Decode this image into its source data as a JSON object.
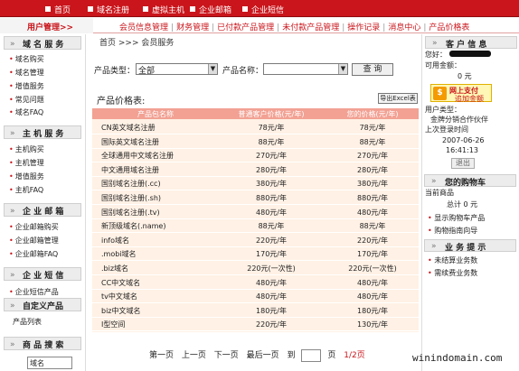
{
  "topnav": {
    "items": [
      "首页",
      "域名注册",
      "虚拟主机",
      "企业邮箱",
      "企业短信"
    ]
  },
  "subnav": {
    "user_area": "用户管理>>",
    "links": [
      "会员信息管理",
      "财务管理",
      "已付款产品管理",
      "未付款产品管理",
      "操作记录",
      "消息中心",
      "产品价格表"
    ]
  },
  "left": {
    "domain_head": "域 名 服 务",
    "domain_items": [
      "域名购买",
      "域名管理",
      "增值服务",
      "常见问题",
      "域名FAQ"
    ],
    "host_head": "主 机 服 务",
    "host_items": [
      "主机购买",
      "主机管理",
      "增值服务",
      "主机FAQ"
    ],
    "mail_head": "企 业 邮 箱",
    "mail_items": [
      "企业邮箱购买",
      "企业邮箱管理",
      "企业邮箱FAQ"
    ],
    "sms_head": "企 业 短 信",
    "sms_items": [
      "企业短信产品"
    ],
    "custom_head": "自定义产品",
    "custom_items": [
      "产品列表"
    ],
    "search_head": "商 品 搜 索",
    "search_value": "域名"
  },
  "main": {
    "breadcrumb": "首页 >>> 会员服务",
    "type_label": "产品类型：",
    "type_value": "全部",
    "name_label": "产品名称：",
    "name_value": "",
    "query_btn": "查  询",
    "price_title": "产品价格表:",
    "excel_btn": "导出Excel表",
    "columns": [
      "产品包名称",
      "普通客户价格(元/年)",
      "您的价格(元/年)"
    ],
    "rows": [
      {
        "name": "CN英文域名注册",
        "p1": "78元/年",
        "p2": "78元/年"
      },
      {
        "name": "国际英文域名注册",
        "p1": "88元/年",
        "p2": "88元/年"
      },
      {
        "name": "全球通用中文域名注册",
        "p1": "270元/年",
        "p2": "270元/年"
      },
      {
        "name": "中文通用域名注册",
        "p1": "280元/年",
        "p2": "280元/年"
      },
      {
        "name": "国别域名注册(.cc)",
        "p1": "380元/年",
        "p2": "380元/年"
      },
      {
        "name": "国别域名注册(.sh)",
        "p1": "880元/年",
        "p2": "880元/年"
      },
      {
        "name": "国别域名注册(.tv)",
        "p1": "480元/年",
        "p2": "480元/年"
      },
      {
        "name": "新顶级域名(.name)",
        "p1": "88元/年",
        "p2": "88元/年"
      },
      {
        "name": "info域名",
        "p1": "220元/年",
        "p2": "220元/年"
      },
      {
        "name": ".mobi域名",
        "p1": "170元/年",
        "p2": "170元/年"
      },
      {
        "name": ".biz域名",
        "p1": "220元(一次性)",
        "p2": "220元(一次性)"
      },
      {
        "name": "CC中文域名",
        "p1": "480元/年",
        "p2": "480元/年"
      },
      {
        "name": "tv中文域名",
        "p1": "480元/年",
        "p2": "480元/年"
      },
      {
        "name": "biz中文域名",
        "p1": "180元/年",
        "p2": "180元/年"
      },
      {
        "name": "I型空间",
        "p1": "220元/年",
        "p2": "130元/年"
      }
    ],
    "pager": {
      "first": "第一页",
      "prev": "上一页",
      "next": "下一页",
      "last": "最后一页",
      "goto": "到",
      "page_unit": "页",
      "page_info": "1/2页"
    }
  },
  "right": {
    "head": "客 户 信 息",
    "hello": "您好：",
    "balance_label": "可用金额：",
    "balance": "0 元",
    "pay_line1": "网上支付",
    "pay_line2": "追加金额",
    "user_label": "用户类型：",
    "user_type": "金牌分销合作伙伴",
    "last_login_label": "上次登录时间",
    "last_login_date": "2007-06-26",
    "last_login_time": "16:41:13",
    "logout": "退出",
    "cart_head": "您的购物车",
    "cart_label": "当前商品",
    "cart_total": "总计 0 元",
    "cart_links": [
      "显示购物车产品",
      "购物指南向导"
    ],
    "tips_head": "业 务 提 示",
    "tips": [
      "未结算业务数",
      "需续费业务数"
    ]
  },
  "watermark": "winindomain.com"
}
